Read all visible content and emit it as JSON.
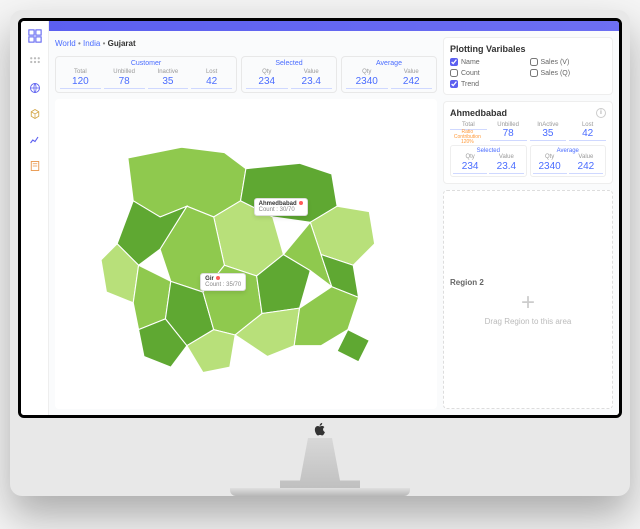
{
  "breadcrumb": {
    "world": "World",
    "india": "India",
    "current": "Gujarat",
    "sep": " • "
  },
  "metrics": {
    "customer": {
      "title": "Customer",
      "cells": [
        {
          "label": "Total",
          "value": "120"
        },
        {
          "label": "Unbilled",
          "value": "78"
        },
        {
          "label": "Inactive",
          "value": "35"
        },
        {
          "label": "Lost",
          "value": "42"
        }
      ]
    },
    "selected": {
      "title": "Selected",
      "cells": [
        {
          "label": "Qty",
          "value": "234"
        },
        {
          "label": "Value",
          "value": "23.4"
        }
      ]
    },
    "average": {
      "title": "Average",
      "cells": [
        {
          "label": "Qty",
          "value": "2340"
        },
        {
          "label": "Value",
          "value": "242"
        }
      ]
    }
  },
  "map": {
    "tooltips": [
      {
        "title": "Ahmedbabad",
        "sub": "Count : 30/70"
      },
      {
        "title": "Gir",
        "sub": "Count : 35/70"
      }
    ]
  },
  "plotting": {
    "title": "Plotting Varibales",
    "options": [
      {
        "label": "Name",
        "checked": true
      },
      {
        "label": "Sales (V)",
        "checked": false
      },
      {
        "label": "Count",
        "checked": false
      },
      {
        "label": "Sales (Q)",
        "checked": false
      },
      {
        "label": "Trend",
        "checked": true
      }
    ]
  },
  "region1": {
    "title": "Ahmedbabad",
    "ratio_label": "Ratio Contribution",
    "ratio_value": "120%",
    "top": [
      {
        "label": "Total",
        "value": ""
      },
      {
        "label": "Unbilled",
        "value": "78"
      },
      {
        "label": "InActive",
        "value": "35"
      },
      {
        "label": "Lost",
        "value": "42"
      }
    ],
    "selected": {
      "title": "Selected",
      "cells": [
        {
          "label": "Qty",
          "value": "234"
        },
        {
          "label": "Value",
          "value": "23.4"
        }
      ]
    },
    "average": {
      "title": "Average",
      "cells": [
        {
          "label": "Qty",
          "value": "2340"
        },
        {
          "label": "Value",
          "value": "242"
        }
      ]
    }
  },
  "region2": {
    "title": "Region 2",
    "placeholder": "Drag Region to this area"
  },
  "colors": {
    "accent": "#5b5ff0",
    "map_light": "#b8e07a",
    "map_mid": "#8fc94e",
    "map_dark": "#5fa832"
  }
}
